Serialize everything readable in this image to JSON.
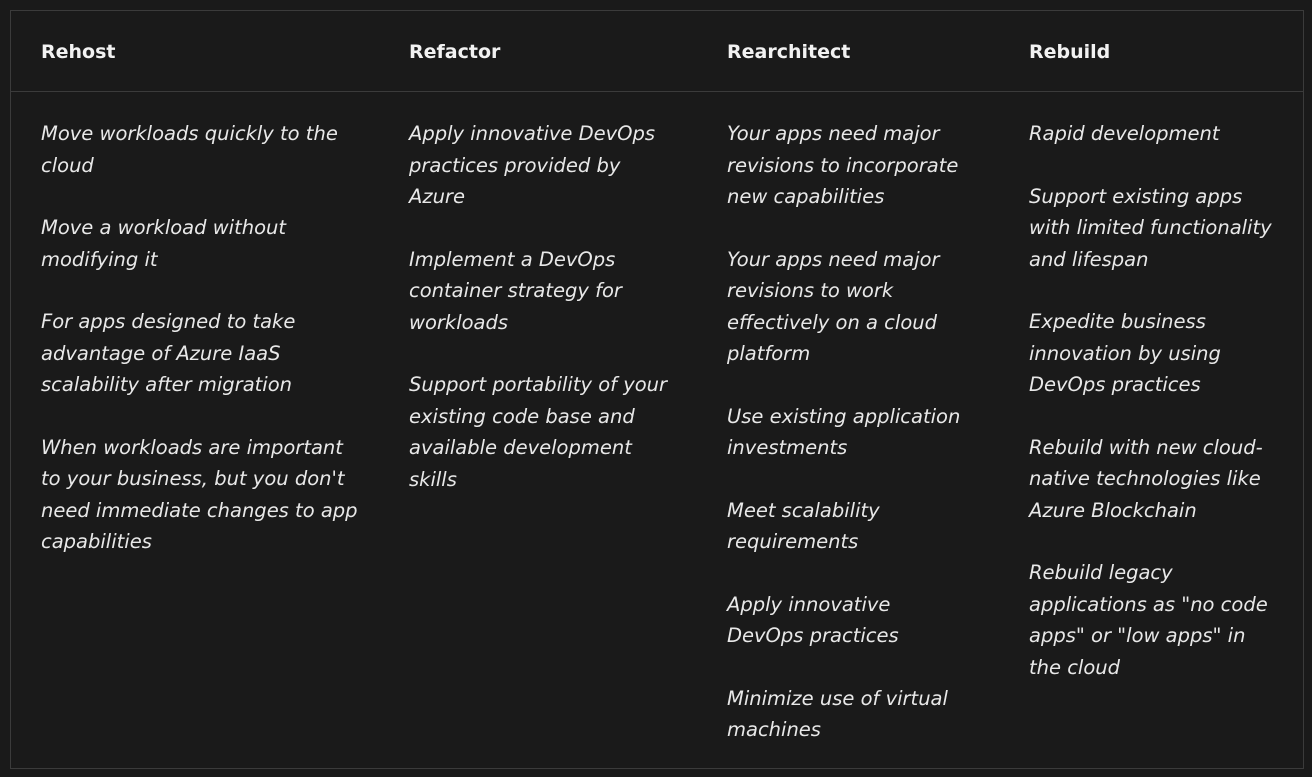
{
  "table": {
    "headers": [
      "Rehost",
      "Refactor",
      "Rearchitect",
      "Rebuild"
    ],
    "columns": [
      [
        "Move workloads quickly to the cloud",
        "Move a workload without modifying it",
        "For apps designed to take advantage of Azure IaaS scalability after migration",
        "When workloads are important to your business, but you don't need immediate changes to app capabilities"
      ],
      [
        "Apply innovative DevOps practices provided by Azure",
        "Implement a DevOps container strategy for workloads",
        "Support portability of your existing code base and available development skills"
      ],
      [
        "Your apps need major revisions to incorporate new capabilities",
        "Your apps need major revisions to work effectively on a cloud platform",
        "Use existing application investments",
        "Meet scalability requirements",
        "Apply innovative DevOps practices",
        "Minimize use of virtual machines"
      ],
      [
        "Rapid development",
        "Support existing apps with limited functionality and lifespan",
        "Expedite business innovation by using DevOps practices",
        "Rebuild with new cloud-native technologies like Azure Blockchain",
        "Rebuild legacy applications as \"no code apps\" or \"low apps\" in the cloud"
      ]
    ]
  }
}
